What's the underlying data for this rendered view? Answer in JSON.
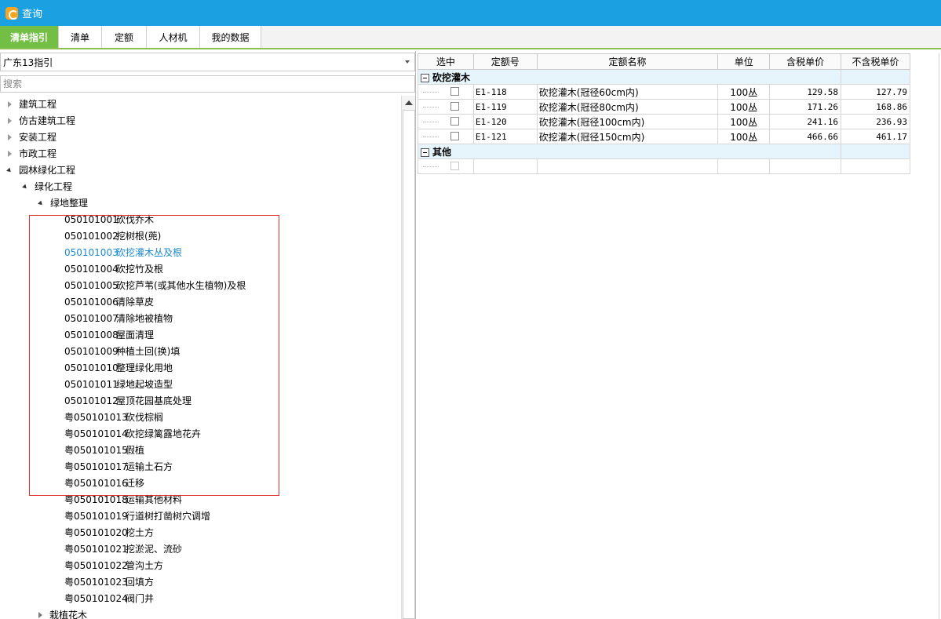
{
  "window": {
    "title": "查询"
  },
  "tabs": [
    {
      "label": "清单指引",
      "active": true
    },
    {
      "label": "清单",
      "active": false
    },
    {
      "label": "定额",
      "active": false
    },
    {
      "label": "人材机",
      "active": false
    },
    {
      "label": "我的数据",
      "active": false
    }
  ],
  "library": {
    "selected": "广东13指引"
  },
  "search": {
    "placeholder": "搜索"
  },
  "tree": {
    "roots": [
      "建筑工程",
      "仿古建筑工程",
      "安装工程",
      "市政工程",
      "园林绿化工程"
    ],
    "level2": "绿化工程",
    "level3": "绿地整理",
    "leaves": [
      {
        "code": "050101001",
        "name": "砍伐乔木"
      },
      {
        "code": "050101002",
        "name": "挖树根(蔸)"
      },
      {
        "code": "050101003",
        "name": "砍挖灌木丛及根"
      },
      {
        "code": "050101004",
        "name": "砍挖竹及根"
      },
      {
        "code": "050101005",
        "name": "砍挖芦苇(或其他水生植物)及根"
      },
      {
        "code": "050101006",
        "name": "清除草皮"
      },
      {
        "code": "050101007",
        "name": "清除地被植物"
      },
      {
        "code": "050101008",
        "name": "屋面清理"
      },
      {
        "code": "050101009",
        "name": "种植土回(换)填"
      },
      {
        "code": "050101010",
        "name": "整理绿化用地"
      },
      {
        "code": "050101011",
        "name": "绿地起坡造型"
      },
      {
        "code": "050101012",
        "name": "屋顶花园基底处理"
      },
      {
        "code": "粤050101013",
        "name": "砍伐棕榈"
      },
      {
        "code": "粤050101014",
        "name": "砍挖绿篱露地花卉"
      },
      {
        "code": "粤050101015",
        "name": "假植"
      },
      {
        "code": "粤050101017",
        "name": "运输土石方"
      },
      {
        "code": "粤050101016",
        "name": "迁移"
      },
      {
        "code": "粤050101018",
        "name": "运输其他材料"
      },
      {
        "code": "粤050101019",
        "name": "行道树打凿树穴调增"
      },
      {
        "code": "粤050101020",
        "name": "挖土方"
      },
      {
        "code": "粤050101021",
        "name": "挖淤泥、流砂"
      },
      {
        "code": "粤050101022",
        "name": "管沟土方"
      },
      {
        "code": "粤050101023",
        "name": "回填方"
      },
      {
        "code": "粤050101024",
        "name": "阀门井"
      }
    ],
    "selected_code": "050101003",
    "next_level3": "栽植花木"
  },
  "grid": {
    "headers": [
      "选中",
      "定额号",
      "定额名称",
      "单位",
      "含税单价",
      "不含税单价"
    ],
    "groups": [
      {
        "name": "砍挖灌木",
        "rows": [
          {
            "code": "E1-118",
            "name": "砍挖灌木(冠径60cm内)",
            "unit": "100丛",
            "price_tax": "129.58",
            "price_notax": "127.79"
          },
          {
            "code": "E1-119",
            "name": "砍挖灌木(冠径80cm内)",
            "unit": "100丛",
            "price_tax": "171.26",
            "price_notax": "168.86"
          },
          {
            "code": "E1-120",
            "name": "砍挖灌木(冠径100cm内)",
            "unit": "100丛",
            "price_tax": "241.16",
            "price_notax": "236.93"
          },
          {
            "code": "E1-121",
            "name": "砍挖灌木(冠径150cm内)",
            "unit": "100丛",
            "price_tax": "466.66",
            "price_notax": "461.17"
          }
        ]
      },
      {
        "name": "其他",
        "rows": []
      }
    ]
  }
}
